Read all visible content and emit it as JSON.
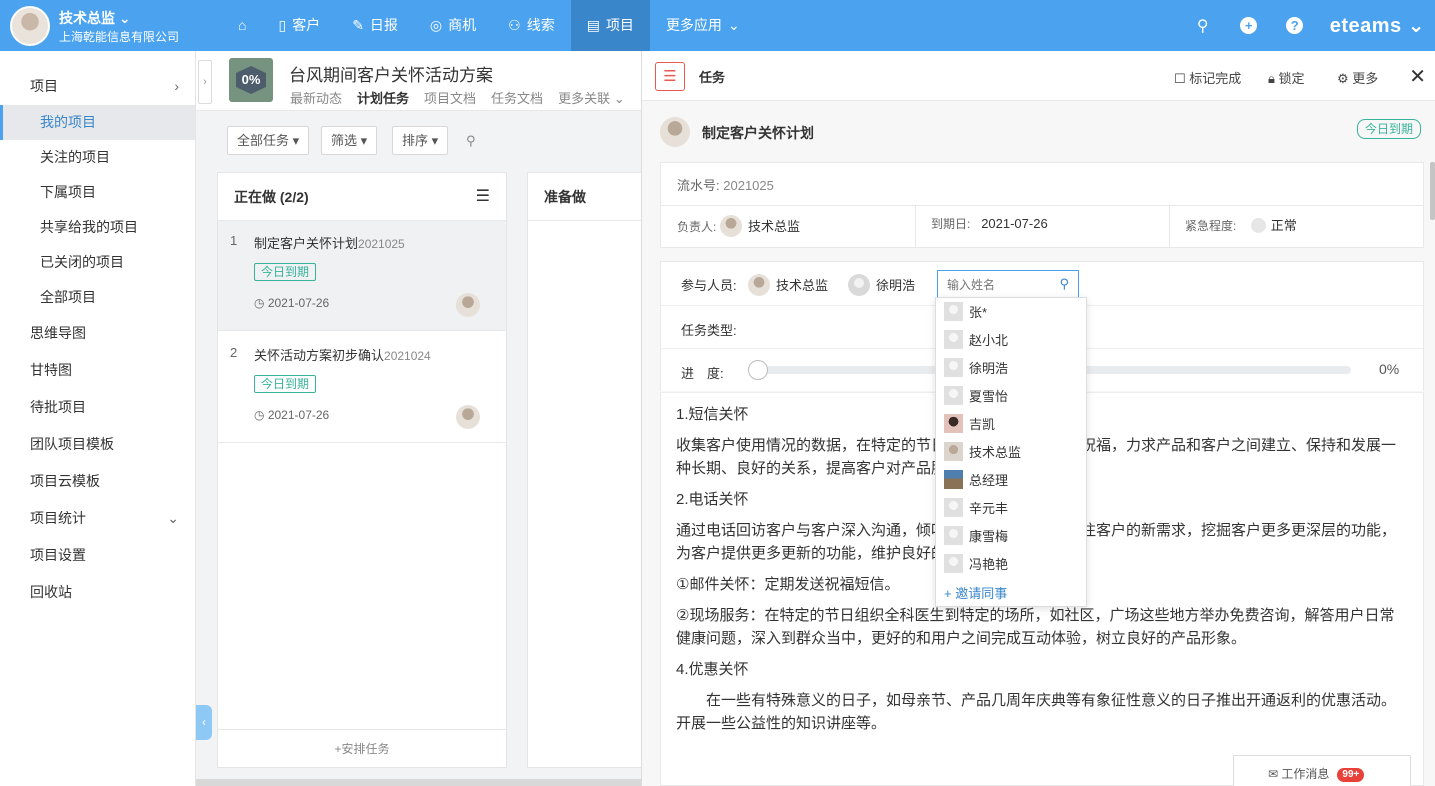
{
  "topbar": {
    "user_name": "技术总监",
    "company": "上海乾能信息有限公司",
    "nav": [
      {
        "label": "客户",
        "icon": "customer-icon"
      },
      {
        "label": "日报",
        "icon": "daily-report-icon"
      },
      {
        "label": "商机",
        "icon": "opportunity-icon"
      },
      {
        "label": "线索",
        "icon": "lead-icon"
      },
      {
        "label": "项目",
        "icon": "project-icon"
      },
      {
        "label": "更多应用",
        "icon": "chevron-down-icon"
      }
    ],
    "logo": "eteams"
  },
  "sidebar": {
    "items": [
      {
        "label": "项目"
      },
      {
        "label": "我的项目"
      },
      {
        "label": "关注的项目"
      },
      {
        "label": "下属项目"
      },
      {
        "label": "共享给我的项目"
      },
      {
        "label": "已关闭的项目"
      },
      {
        "label": "全部项目"
      },
      {
        "label": "思维导图"
      },
      {
        "label": "甘特图"
      },
      {
        "label": "待批项目"
      },
      {
        "label": "团队项目模板"
      },
      {
        "label": "项目云模板"
      },
      {
        "label": "项目统计"
      },
      {
        "label": "项目设置"
      },
      {
        "label": "回收站"
      }
    ]
  },
  "project": {
    "progress": "0%",
    "title": "台风期间客户关怀活动方案",
    "tabs": [
      "最新动态",
      "计划任务",
      "项目文档",
      "任务文档",
      "更多关联"
    ],
    "filters": [
      "全部任务",
      "筛选",
      "排序"
    ]
  },
  "columns": {
    "doing": {
      "title": "正在做 (2/2)",
      "cards": [
        {
          "no": "1",
          "title": "制定客户关怀计划",
          "code": "2021025",
          "tag": "今日到期",
          "date": "2021-07-26"
        },
        {
          "no": "2",
          "title": "关怀活动方案初步确认",
          "code": "2021024",
          "tag": "今日到期",
          "date": "2021-07-26"
        }
      ],
      "add_task": "+安排任务"
    },
    "todo": {
      "title": "准备做"
    }
  },
  "detail": {
    "header": "任务",
    "actions": {
      "mark_done": "标记完成",
      "lock": "锁定",
      "more": "更多"
    },
    "task_title": "制定客户关怀计划",
    "due_tag": "今日到期",
    "serial_label": "流水号:",
    "serial": "2021025",
    "owner_label": "负责人:",
    "owner": "技术总监",
    "due_label": "到期日:",
    "due_date": "2021-07-26",
    "urgency_label": "紧急程度:",
    "urgency": "正常",
    "participants_label": "参与人员:",
    "participants": [
      "技术总监",
      "徐明浩"
    ],
    "name_placeholder": "输入姓名",
    "task_type_label": "任务类型:",
    "progress_label": "进　度:",
    "progress_value": "0%",
    "progress_fraction": 0,
    "description": [
      "1.短信关怀",
      "收集客户使用情况的数据，在特定的节日、客户生日发送短信祝福，力求产品和客户之间建立、保持和发展一种长期、良好的关系，提高客户对产品服务的满意度。",
      "2.电话关怀",
      "通过电话回访客户与客户深入沟通，倾听客户的声音，针对关注客户的新需求，挖掘客户更多更深层的功能，为客户提供更多更新的功能，维护良好的关怀氛围。",
      "①邮件关怀：定期发送祝福短信。",
      "②现场服务：在特定的节日组织全科医生到特定的场所，如社区，广场这些地方举办免费咨询，解答用户日常健康问题，深入到群众当中，更好的和用户之间完成互动体验，树立良好的产品形象。",
      "4.优惠关怀",
      "　　在一些有特殊意义的日子，如母亲节、产品几周年庆典等有象征性意义的日子推出开通返利的优惠活动。开展一些公益性的知识讲座等。"
    ]
  },
  "dropdown": {
    "people": [
      "张*",
      "赵小北",
      "徐明浩",
      "夏雪怡",
      "吉凯",
      "技术总监",
      "总经理",
      "辛元丰",
      "康雪梅",
      "冯艳艳"
    ],
    "invite": "邀请同事"
  },
  "messages": {
    "label": "工作消息",
    "count": "99+"
  }
}
